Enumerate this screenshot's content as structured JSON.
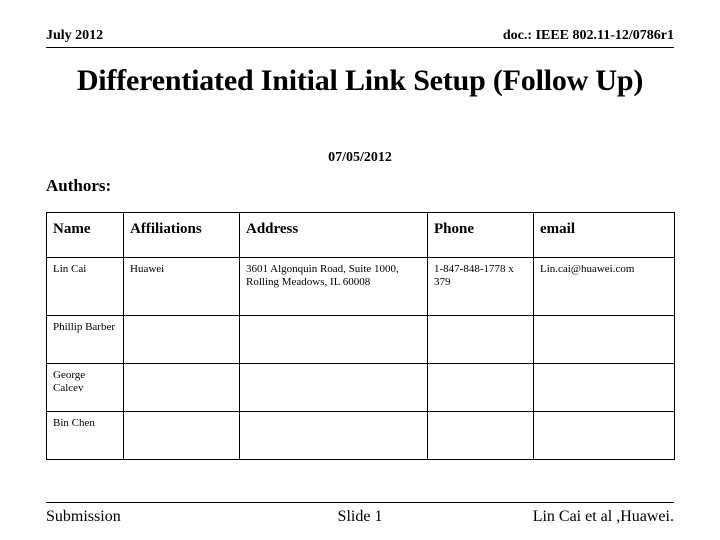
{
  "document": {
    "type": "ieee-submission-slide"
  },
  "header": {
    "left": "July 2012",
    "right": "doc.: IEEE 802.11-12/0786r1"
  },
  "title": {
    "text": "Differentiated Initial Link Setup (Follow Up)"
  },
  "date": {
    "text": "07/05/2012"
  },
  "authors_section": {
    "label": "Authors:"
  },
  "authors_table": {
    "columns": [
      "Name",
      "Affiliations",
      "Address",
      "Phone",
      "email"
    ],
    "rows": [
      {
        "name": "Lin Cai",
        "affiliations": "Huawei",
        "address": "3601 Algonquin Road, Suite 1000, Rolling Meadows, IL 60008",
        "phone": "1-847-848-1778 x 379",
        "email": "Lin.cai@huawei.com"
      },
      {
        "name": "Phillip Barber",
        "affiliations": "",
        "address": "",
        "phone": "",
        "email": ""
      },
      {
        "name": "George Calcev",
        "affiliations": "",
        "address": "",
        "phone": "",
        "email": ""
      },
      {
        "name": "Bin Chen",
        "affiliations": "",
        "address": "",
        "phone": "",
        "email": ""
      }
    ]
  },
  "footer": {
    "left": "Submission",
    "center": "Slide 1",
    "right": "Lin Cai et al ,Huawei."
  },
  "colors": {
    "text": "#000000",
    "background": "#ffffff",
    "rule": "#000000"
  }
}
